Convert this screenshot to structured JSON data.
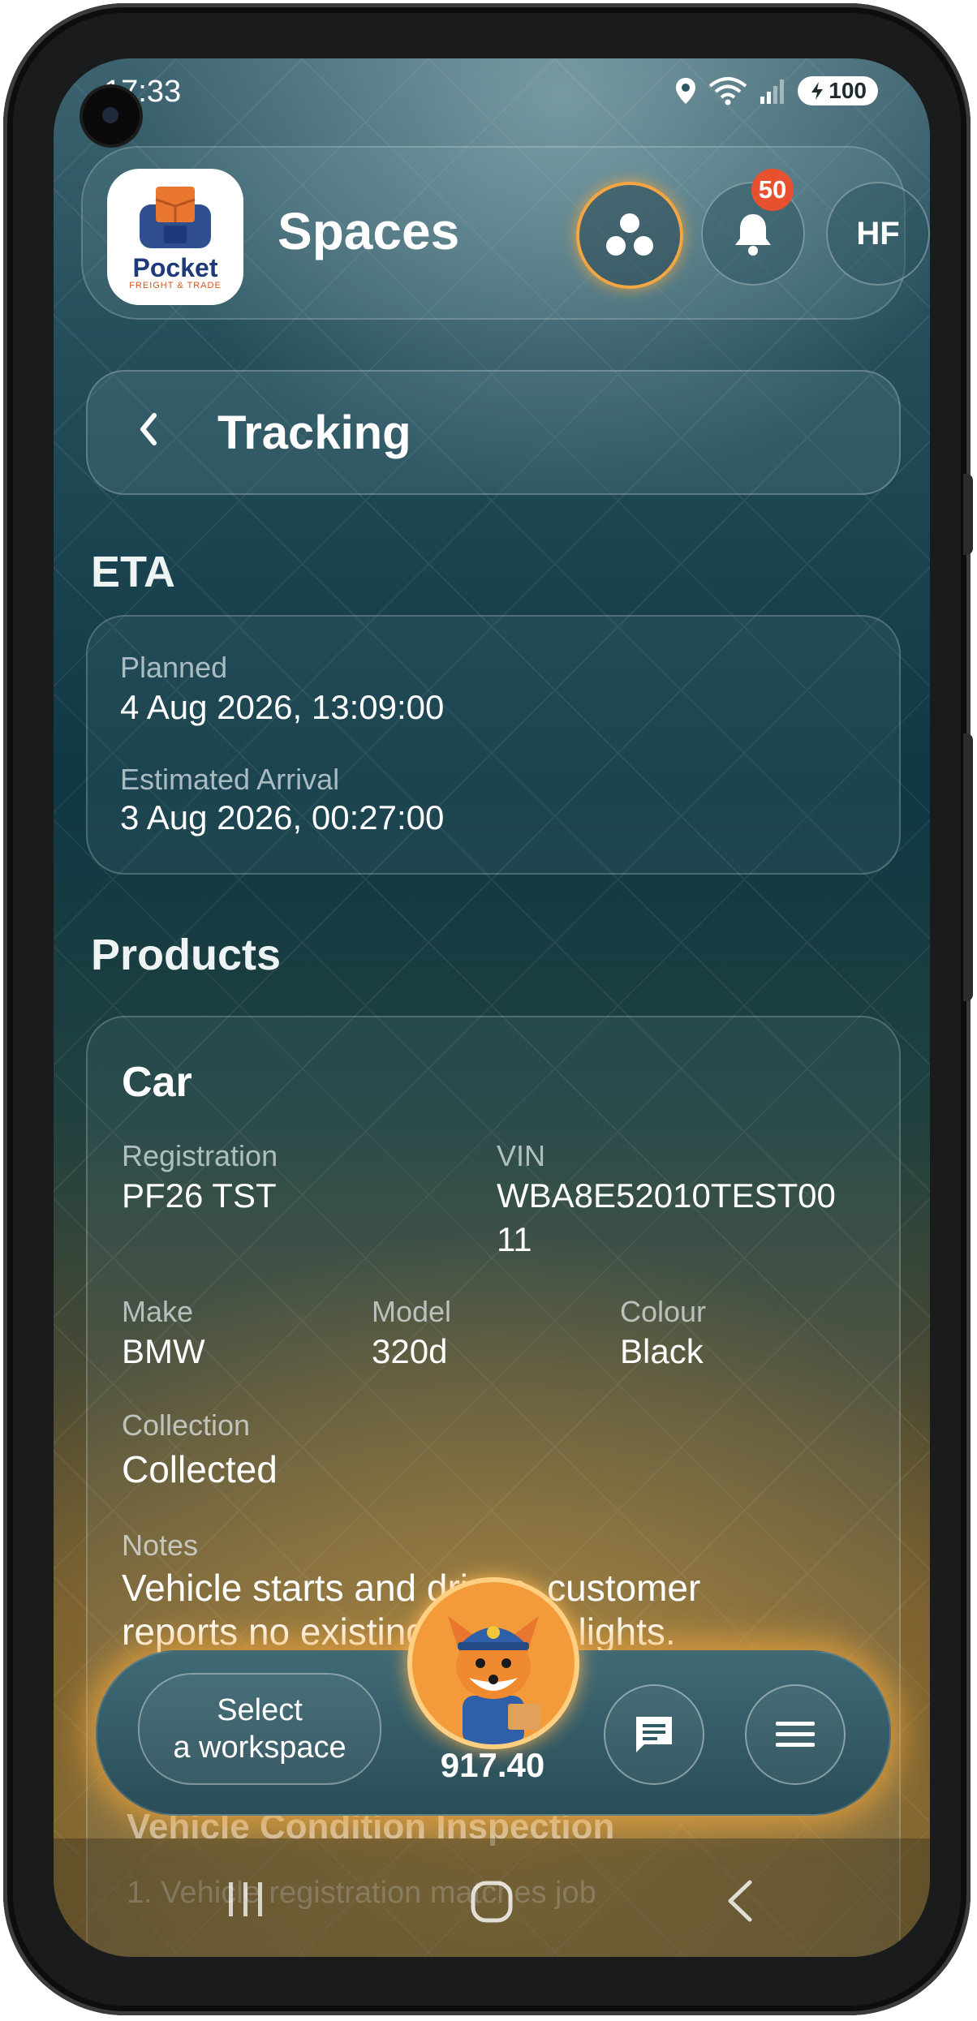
{
  "status_bar": {
    "time": "17:33",
    "battery": "100"
  },
  "header": {
    "logo_text": "Pocket",
    "logo_subtext": "FREIGHT & TRADE",
    "title": "Spaces",
    "notification_count": "50",
    "avatar_initials": "HF"
  },
  "tracking": {
    "title": "Tracking"
  },
  "eta": {
    "section_title": "ETA",
    "planned_label": "Planned",
    "planned_value": "4 Aug 2026, 13:09:00",
    "estimated_label": "Estimated Arrival",
    "estimated_value": "3 Aug 2026, 00:27:00"
  },
  "products": {
    "section_title": "Products",
    "item": {
      "title": "Car",
      "registration_label": "Registration",
      "registration_value": "PF26 TST",
      "vin_label": "VIN",
      "vin_value_line1": "WBA8E52010TEST00",
      "vin_value_line2": "11",
      "make_label": "Make",
      "make_value": "BMW",
      "model_label": "Model",
      "model_value": "320d",
      "colour_label": "Colour",
      "colour_value": "Black",
      "collection_label": "Collection",
      "collection_value": "Collected",
      "notes_label": "Notes",
      "notes_line1": "Vehicle starts and drives, customer",
      "notes_line2": "reports no existing warning lights."
    },
    "inspection_title": "Vehicle Condition Inspection",
    "inspection_item_1": "1. Vehicle registration matches job"
  },
  "bottom_bar": {
    "workspace_line1": "Select",
    "workspace_line2": "a workspace",
    "balance": "917.40"
  },
  "colors": {
    "accent": "#f3a641",
    "badge": "#e8512f",
    "bg_top": "#3d6370",
    "bg_bottom": "#7a6231"
  }
}
